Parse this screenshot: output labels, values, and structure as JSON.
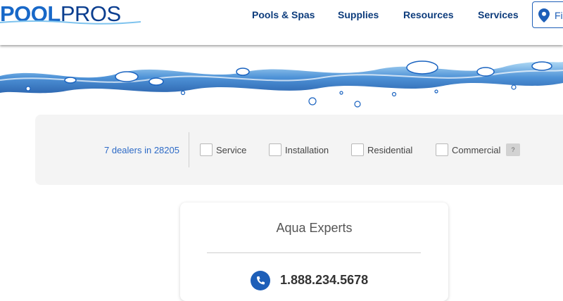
{
  "header": {
    "logo_part1": "POOL",
    "logo_part2": "PROS",
    "nav": [
      "Pools & Spas",
      "Supplies",
      "Resources",
      "Services"
    ],
    "find_label": "Fi"
  },
  "filters": {
    "dealer_count": "7 dealers in 28205",
    "options": [
      "Service",
      "Installation",
      "Residential",
      "Commercial"
    ],
    "help_label": "?"
  },
  "dealer": {
    "name": "Aqua Experts",
    "phone": "1.888.234.5678"
  },
  "colors": {
    "brand_blue": "#1868c8",
    "nav_text": "#0d3c7c",
    "link_blue": "#2d6ac6"
  }
}
